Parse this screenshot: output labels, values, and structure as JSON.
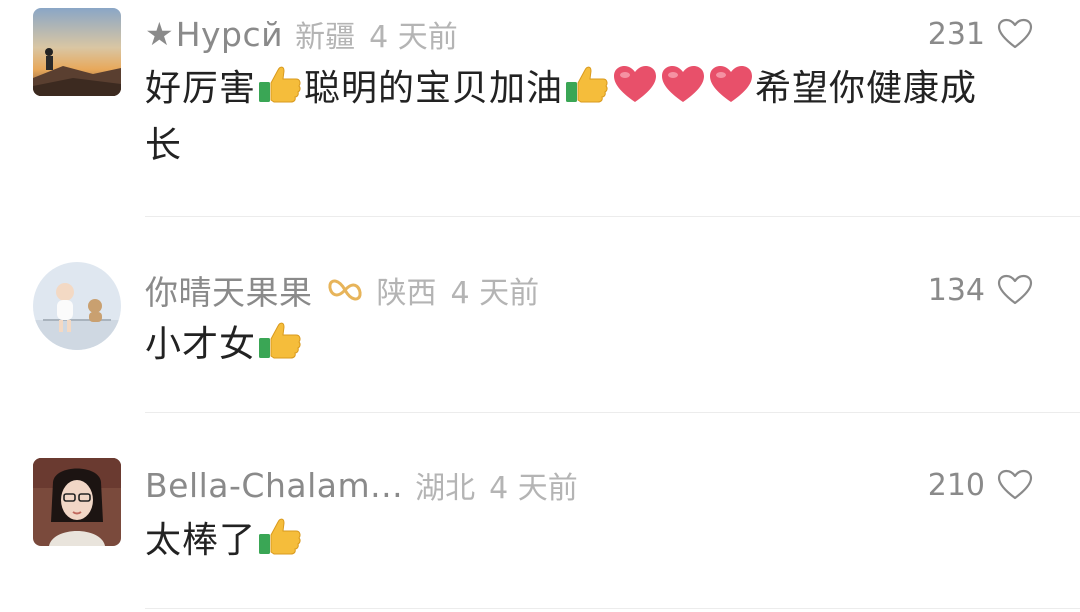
{
  "comments": [
    {
      "username": "Нурсй",
      "location": "新疆",
      "time": "4 天前",
      "likes": "231",
      "text_parts": [
        "好厉害",
        "聪明的宝贝加油",
        "希望你健康成长"
      ]
    },
    {
      "username": "你晴天果果",
      "location": "陕西",
      "time": "4 天前",
      "likes": "134",
      "text_parts": [
        "小才女"
      ]
    },
    {
      "username": "Bella-Chalam...",
      "location": "湖北",
      "time": "4 天前",
      "likes": "210",
      "text_parts": [
        "太棒了"
      ]
    }
  ],
  "icons": {
    "like": "heart-outline-icon",
    "thumbs": "thumbs-up-icon",
    "red_heart": "red-heart-icon",
    "badge": "gold-infinity-badge-icon"
  },
  "colors": {
    "username": "#8a8a8a",
    "meta": "#b4b4b4",
    "text": "#222222",
    "heart_emoji": "#e8506a",
    "badge": "#e7b45a"
  }
}
